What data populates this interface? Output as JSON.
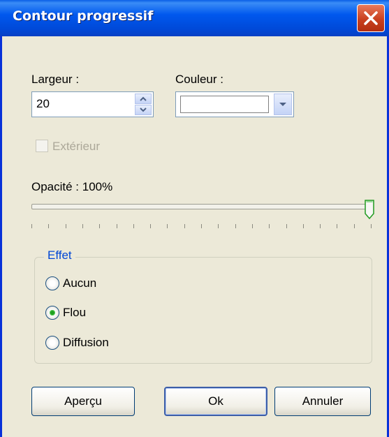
{
  "window": {
    "title": "Contour progressif"
  },
  "width": {
    "label": "Largeur :",
    "value": "20"
  },
  "color": {
    "label": "Couleur :",
    "swatch": "#ffffff"
  },
  "exterior": {
    "label": "Extérieur",
    "checked": false,
    "enabled": false
  },
  "opacity": {
    "label": "Opacité : 100%",
    "value_percent": 100
  },
  "effect": {
    "legend": "Effet",
    "options": [
      {
        "label": "Aucun",
        "selected": false
      },
      {
        "label": "Flou",
        "selected": true
      },
      {
        "label": "Diffusion",
        "selected": false
      }
    ]
  },
  "buttons": {
    "preview": "Aperçu",
    "ok": "Ok",
    "cancel": "Annuler"
  },
  "colors": {
    "titlebar": "#0058ee",
    "accent": "#0046d5",
    "radio_dot": "#21a121",
    "face": "#ece9d8"
  }
}
